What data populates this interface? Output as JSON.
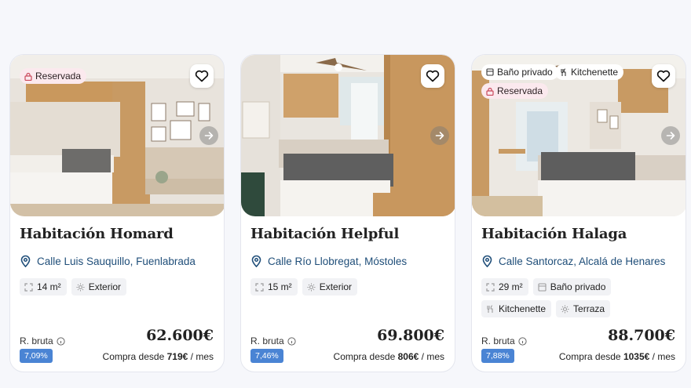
{
  "colors": {
    "accent_blue": "#4a84d4",
    "address_blue": "#1f4e79",
    "reserved_bg": "#fbe9ee"
  },
  "cards": [
    {
      "title": "Habitación Homard",
      "address": "Calle Luis Sauquillo, Fuenlabrada",
      "tags": [
        "Reservada"
      ],
      "chips": [
        "14 m²",
        "Exterior"
      ],
      "rentability_label": "R. bruta",
      "rentability": "7,09%",
      "price": "62.600€",
      "monthly_prefix": "Compra desde",
      "monthly_amount": "719€",
      "monthly_suffix": "/ mes"
    },
    {
      "title": "Habitación Helpful",
      "address": "Calle Río Llobregat, Móstoles",
      "tags": [],
      "chips": [
        "15 m²",
        "Exterior"
      ],
      "rentability_label": "R. bruta",
      "rentability": "7,46%",
      "price": "69.800€",
      "monthly_prefix": "Compra desde",
      "monthly_amount": "806€",
      "monthly_suffix": "/ mes"
    },
    {
      "title": "Habitación Halaga",
      "address": "Calle Santorcaz, Alcalá de Henares",
      "tags": [
        "Baño privado",
        "Kitchenette",
        "Reservada"
      ],
      "chips": [
        "29 m²",
        "Baño privado",
        "Kitchenette",
        "Terraza"
      ],
      "rentability_label": "R. bruta",
      "rentability": "7,88%",
      "price": "88.700€",
      "monthly_prefix": "Compra desde",
      "monthly_amount": "1035€",
      "monthly_suffix": "/ mes"
    }
  ]
}
